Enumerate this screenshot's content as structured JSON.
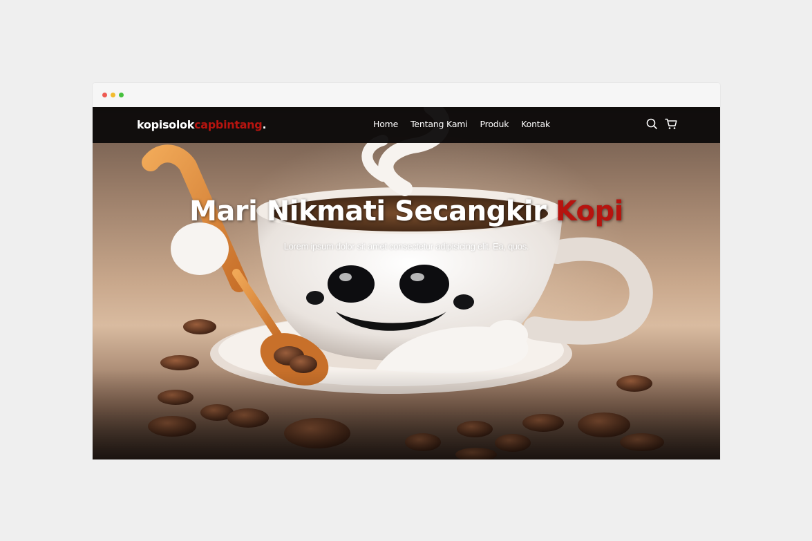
{
  "window": {
    "controls": [
      "close",
      "minimize",
      "maximize"
    ]
  },
  "nav": {
    "brand_primary": "kopisolok",
    "brand_accent": "capbintang",
    "brand_dot": ".",
    "links": [
      "Home",
      "Tentang Kami",
      "Produk",
      "Kontak"
    ],
    "icons": [
      "search-icon",
      "cart-icon"
    ]
  },
  "hero": {
    "title_main": "Mari Nikmati Secangkir",
    "title_accent": "Kopi",
    "subtitle": "Lorem ipsum dolor sit amet consectetur adipisicing elit. Ea, quos.",
    "image": "coffee-cup-mascot-illustration"
  },
  "colors": {
    "accent": "#b6140f",
    "navbar": "#0c0a09",
    "page_bg": "#efefef"
  }
}
